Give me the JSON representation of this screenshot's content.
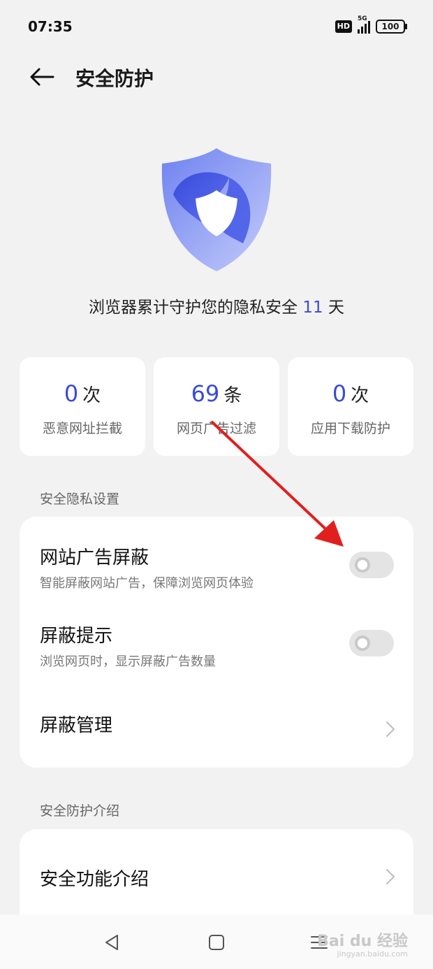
{
  "status_bar": {
    "time": "07:35",
    "hd": "HD",
    "network": "5G",
    "battery": "100"
  },
  "header": {
    "title": "安全防护"
  },
  "hero": {
    "text_prefix": "浏览器累计守护您的隐私安全 ",
    "days": "11",
    "text_suffix": " 天",
    "shield_colors": [
      "#3a4bd6",
      "#8a9cf4",
      "#c7d0fb"
    ]
  },
  "stats": [
    {
      "value": "0",
      "unit": "次",
      "label": "恶意网址拦截"
    },
    {
      "value": "69",
      "unit": "条",
      "label": "网页广告过滤"
    },
    {
      "value": "0",
      "unit": "次",
      "label": "应用下载防护"
    }
  ],
  "privacy_section": {
    "label": "安全隐私设置",
    "items": [
      {
        "title": "网站广告屏蔽",
        "subtitle": "智能屏蔽网站广告，保障浏览网页体验",
        "enabled": false
      },
      {
        "title": "屏蔽提示",
        "subtitle": "浏览网页时，显示屏蔽广告数量",
        "enabled": false
      },
      {
        "title": "屏蔽管理"
      }
    ]
  },
  "intro_section": {
    "label": "安全防护介绍",
    "items": [
      {
        "title": "安全功能介绍"
      }
    ]
  },
  "watermark": {
    "brand": "Bai du 经验",
    "url": "jingyan.baidu.com"
  },
  "colors": {
    "accent": "#3a4bd6",
    "annotation_arrow": "#e0201f"
  }
}
